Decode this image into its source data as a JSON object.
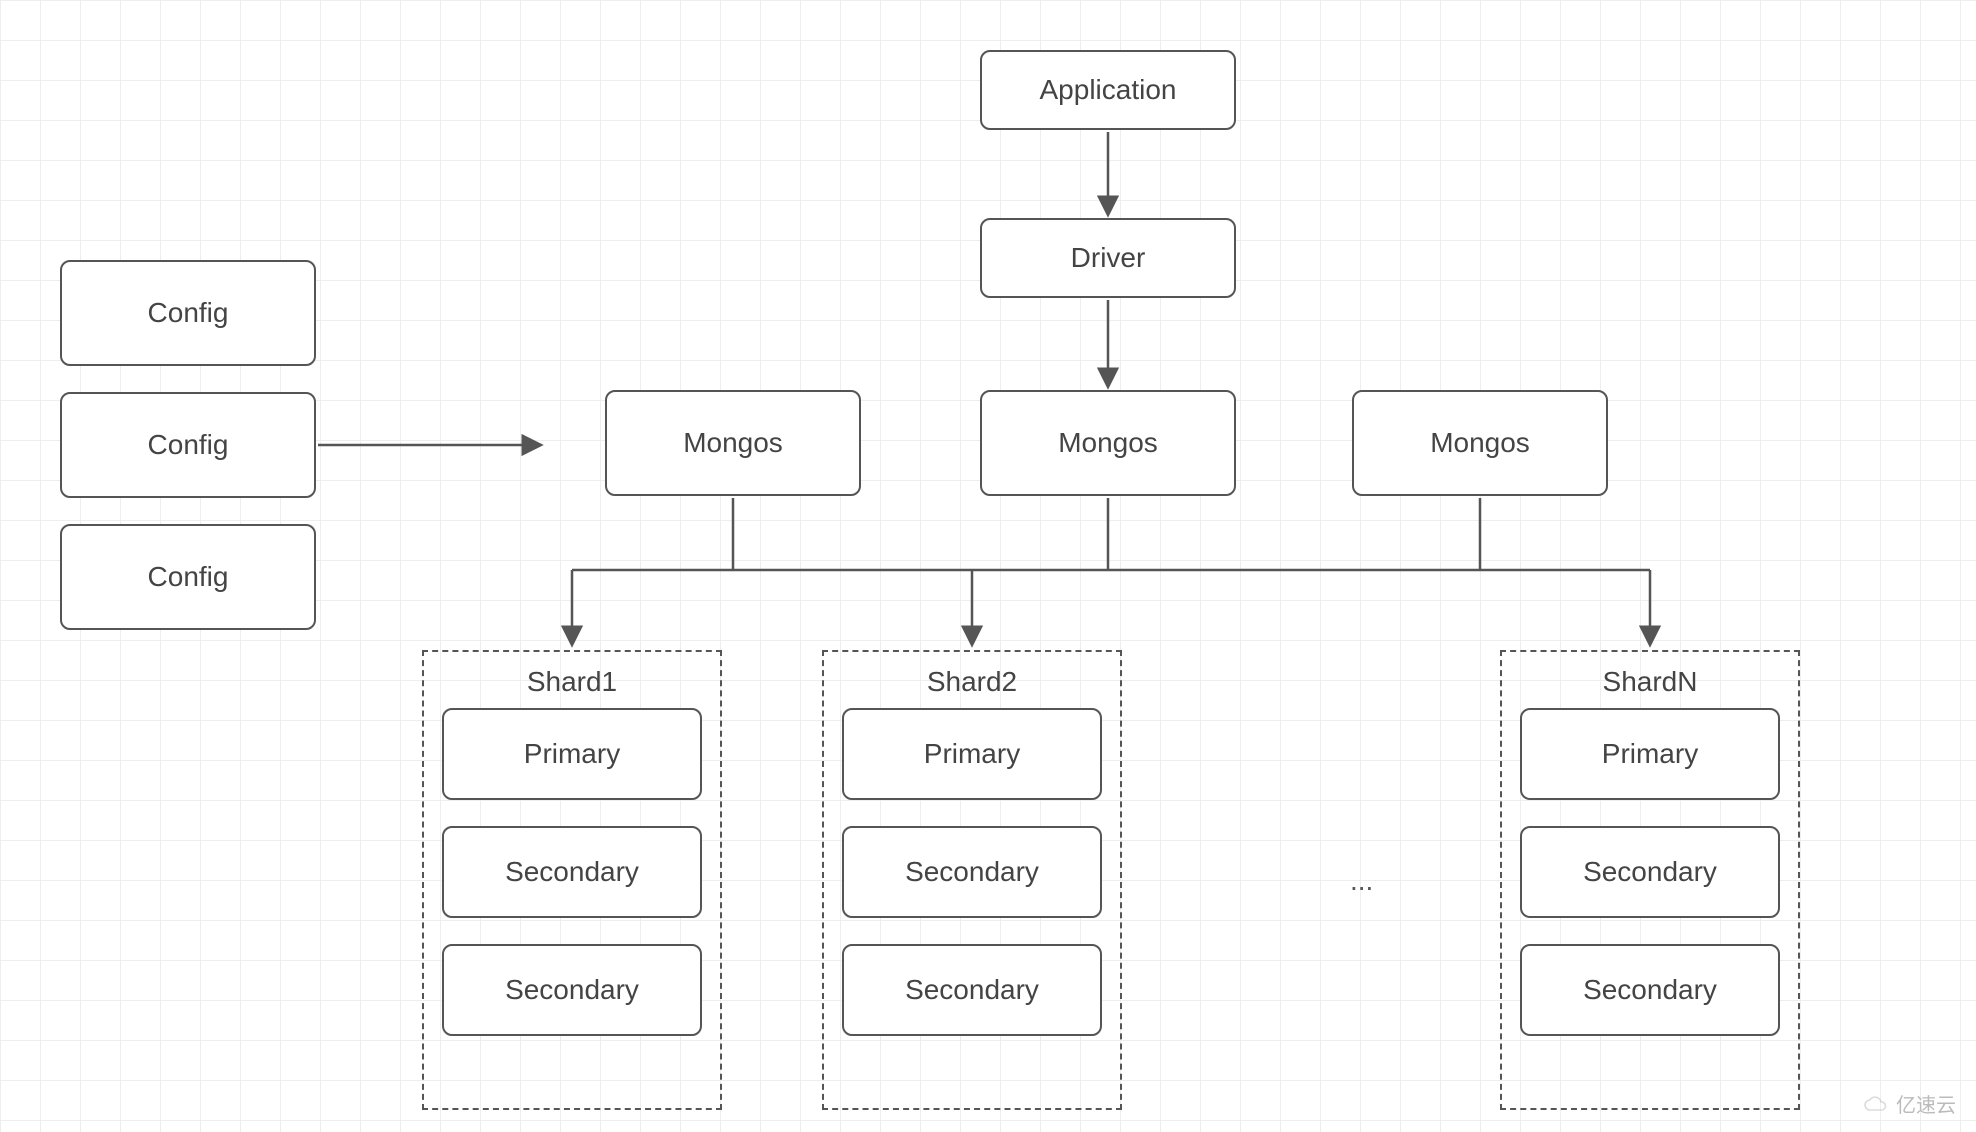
{
  "nodes": {
    "application": "Application",
    "driver": "Driver",
    "mongos": [
      "Mongos",
      "Mongos",
      "Mongos"
    ],
    "config": [
      "Config",
      "Config",
      "Config"
    ]
  },
  "shards": [
    {
      "label": "Shard1",
      "members": [
        "Primary",
        "Secondary",
        "Secondary"
      ]
    },
    {
      "label": "Shard2",
      "members": [
        "Primary",
        "Secondary",
        "Secondary"
      ]
    },
    {
      "label": "ShardN",
      "members": [
        "Primary",
        "Secondary",
        "Secondary"
      ]
    }
  ],
  "ellipsis": "...",
  "watermark": "亿速云",
  "diagram_description": "MongoDB sharded cluster architecture. Application connects through a Driver to a layer of Mongos routers. Config servers (a replica set of three Config nodes) provide cluster metadata to the Mongos routers. Each Mongos routes queries to shards (Shard1, Shard2, …, ShardN), each shard being a replica set of one Primary and two Secondary nodes."
}
